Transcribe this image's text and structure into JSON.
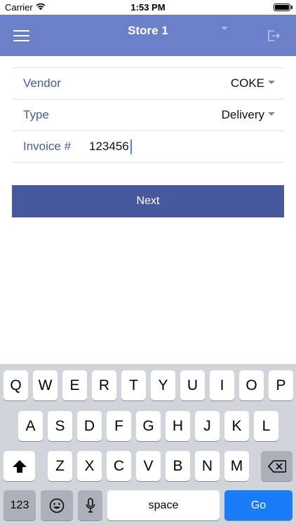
{
  "status_bar": {
    "carrier": "Carrier",
    "time": "1:53 PM",
    "wifi_icon": "wifi-icon",
    "battery_icon": "battery-icon"
  },
  "nav": {
    "title": "Store 1",
    "menu_icon": "hamburger-menu-icon",
    "dropdown_icon": "caret-down-icon",
    "logout_icon": "logout-icon",
    "background": "#6b80c8"
  },
  "form": {
    "vendor": {
      "label": "Vendor",
      "value": "COKE"
    },
    "type": {
      "label": "Type",
      "value": "Delivery"
    },
    "invoice": {
      "label": "Invoice #",
      "value": "123456"
    }
  },
  "next_button": {
    "label": "Next",
    "color": "#48589c"
  },
  "keyboard": {
    "row1": [
      "Q",
      "W",
      "E",
      "R",
      "T",
      "Y",
      "U",
      "I",
      "O",
      "P"
    ],
    "row2": [
      "A",
      "S",
      "D",
      "F",
      "G",
      "H",
      "J",
      "K",
      "L"
    ],
    "row3": [
      "Z",
      "X",
      "C",
      "V",
      "B",
      "N",
      "M"
    ],
    "shift_icon": "shift-arrow-icon",
    "delete_icon": "backspace-icon",
    "numbers_label": "123",
    "emoji_icon": "emoji-icon",
    "mic_icon": "microphone-icon",
    "space_label": "space",
    "go_label": "Go",
    "go_color": "#1a7cf6"
  }
}
